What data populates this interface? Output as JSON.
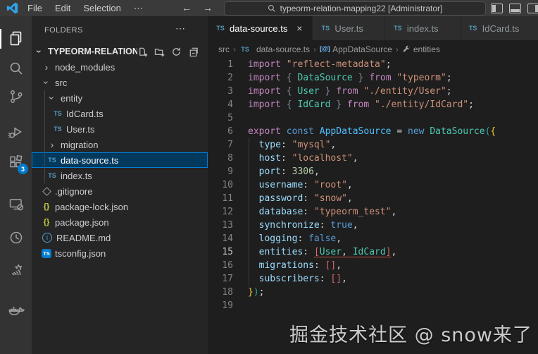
{
  "title_bar": {
    "menus": [
      "File",
      "Edit",
      "Selection"
    ],
    "more_menu": "⋯",
    "back_arrow": "←",
    "forward_arrow": "→",
    "search_text": "typeorm-relation-mapping22 [Administrator]"
  },
  "activity_bar": {
    "items": [
      {
        "name": "explorer",
        "active": true
      },
      {
        "name": "search"
      },
      {
        "name": "source-control"
      },
      {
        "name": "run-and-debug"
      },
      {
        "name": "extensions",
        "badge": "3"
      },
      {
        "name": "remote-explorer"
      },
      {
        "name": "clock"
      },
      {
        "name": "hand"
      },
      {
        "name": "docker"
      }
    ]
  },
  "sidebar": {
    "header": "FOLDERS",
    "header_more": "⋯",
    "root": {
      "label": "TYPEORM-RELATION-...",
      "expanded": true
    },
    "tree": [
      {
        "label": "node_modules",
        "depth": 1,
        "kind": "folder",
        "expanded": false
      },
      {
        "label": "src",
        "depth": 1,
        "kind": "folder",
        "expanded": true
      },
      {
        "label": "entity",
        "depth": 2,
        "kind": "folder",
        "expanded": true
      },
      {
        "label": "IdCard.ts",
        "depth": 3,
        "kind": "file",
        "icon": "ts"
      },
      {
        "label": "User.ts",
        "depth": 3,
        "kind": "file",
        "icon": "ts"
      },
      {
        "label": "migration",
        "depth": 2,
        "kind": "folder",
        "expanded": false
      },
      {
        "label": "data-source.ts",
        "depth": 2,
        "kind": "file",
        "icon": "ts",
        "selected": true
      },
      {
        "label": "index.ts",
        "depth": 2,
        "kind": "file",
        "icon": "ts"
      },
      {
        "label": ".gitignore",
        "depth": 1,
        "kind": "file",
        "icon": "git"
      },
      {
        "label": "package-lock.json",
        "depth": 1,
        "kind": "file",
        "icon": "json"
      },
      {
        "label": "package.json",
        "depth": 1,
        "kind": "file",
        "icon": "json"
      },
      {
        "label": "README.md",
        "depth": 1,
        "kind": "file",
        "icon": "info"
      },
      {
        "label": "tsconfig.json",
        "depth": 1,
        "kind": "file",
        "icon": "tsconfig"
      }
    ]
  },
  "editor_tabs": [
    {
      "label": "data-source.ts",
      "active": true
    },
    {
      "label": "User.ts"
    },
    {
      "label": "index.ts"
    },
    {
      "label": "IdCard.ts"
    }
  ],
  "breadcrumb": {
    "separator": "›",
    "items": [
      {
        "label": "src"
      },
      {
        "label": "data-source.ts",
        "icon": "ts"
      },
      {
        "label": "AppDataSource",
        "icon": "symbol-variable"
      },
      {
        "label": "entities",
        "icon": "symbol-property"
      }
    ]
  },
  "icons": {
    "ts": "TS",
    "json": "{}",
    "info": "i",
    "chevron": "›",
    "close": "×",
    "variable": "[@]"
  },
  "editor": {
    "active_line": 15,
    "lines": [
      {
        "n": 1,
        "tokens": [
          [
            "kw1",
            "import"
          ],
          [
            "pl",
            " "
          ],
          [
            "str",
            "\"reflect-metadata\""
          ],
          [
            "pl",
            ";"
          ]
        ]
      },
      {
        "n": 2,
        "tokens": [
          [
            "kw1",
            "import"
          ],
          [
            "pl",
            " "
          ],
          [
            "bd",
            "{"
          ],
          [
            "pl",
            " "
          ],
          [
            "typ",
            "DataSource"
          ],
          [
            "pl",
            " "
          ],
          [
            "bd",
            "}"
          ],
          [
            "pl",
            " "
          ],
          [
            "kw1",
            "from"
          ],
          [
            "pl",
            " "
          ],
          [
            "str",
            "\"typeorm\""
          ],
          [
            "pl",
            ";"
          ]
        ]
      },
      {
        "n": 3,
        "tokens": [
          [
            "kw1",
            "import"
          ],
          [
            "pl",
            " "
          ],
          [
            "bd",
            "{"
          ],
          [
            "pl",
            " "
          ],
          [
            "typ",
            "User"
          ],
          [
            "pl",
            " "
          ],
          [
            "bd",
            "}"
          ],
          [
            "pl",
            " "
          ],
          [
            "kw1",
            "from"
          ],
          [
            "pl",
            " "
          ],
          [
            "str",
            "\"./entity/User\""
          ],
          [
            "pl",
            ";"
          ]
        ]
      },
      {
        "n": 4,
        "tokens": [
          [
            "kw1",
            "import"
          ],
          [
            "pl",
            " "
          ],
          [
            "bd",
            "{"
          ],
          [
            "pl",
            " "
          ],
          [
            "typ",
            "IdCard"
          ],
          [
            "pl",
            " "
          ],
          [
            "bd",
            "}"
          ],
          [
            "pl",
            " "
          ],
          [
            "kw1",
            "from"
          ],
          [
            "pl",
            " "
          ],
          [
            "str",
            "\"./entity/IdCard\""
          ],
          [
            "pl",
            ";"
          ]
        ]
      },
      {
        "n": 5,
        "tokens": []
      },
      {
        "n": 6,
        "tokens": [
          [
            "kw1",
            "export"
          ],
          [
            "pl",
            " "
          ],
          [
            "kw2",
            "const"
          ],
          [
            "pl",
            " "
          ],
          [
            "cn",
            "AppDataSource"
          ],
          [
            "pl",
            " = "
          ],
          [
            "kw2",
            "new"
          ],
          [
            "pl",
            " "
          ],
          [
            "typ",
            "DataSource"
          ],
          [
            "pa",
            "("
          ],
          [
            "cu",
            "{"
          ]
        ]
      },
      {
        "n": 7,
        "tokens": [
          [
            "pl",
            "  "
          ],
          [
            "pr",
            "type"
          ],
          [
            "pl",
            ": "
          ],
          [
            "str",
            "\"mysql\""
          ],
          [
            "pl",
            ","
          ]
        ]
      },
      {
        "n": 8,
        "tokens": [
          [
            "pl",
            "  "
          ],
          [
            "pr",
            "host"
          ],
          [
            "pl",
            ": "
          ],
          [
            "str",
            "\"localhost\""
          ],
          [
            "pl",
            ","
          ]
        ]
      },
      {
        "n": 9,
        "tokens": [
          [
            "pl",
            "  "
          ],
          [
            "pr",
            "port"
          ],
          [
            "pl",
            ": "
          ],
          [
            "num",
            "3306"
          ],
          [
            "pl",
            ","
          ]
        ]
      },
      {
        "n": 10,
        "tokens": [
          [
            "pl",
            "  "
          ],
          [
            "pr",
            "username"
          ],
          [
            "pl",
            ": "
          ],
          [
            "str",
            "\"root\""
          ],
          [
            "pl",
            ","
          ]
        ]
      },
      {
        "n": 11,
        "tokens": [
          [
            "pl",
            "  "
          ],
          [
            "pr",
            "password"
          ],
          [
            "pl",
            ": "
          ],
          [
            "str",
            "\"snow\""
          ],
          [
            "pl",
            ","
          ]
        ]
      },
      {
        "n": 12,
        "tokens": [
          [
            "pl",
            "  "
          ],
          [
            "pr",
            "database"
          ],
          [
            "pl",
            ": "
          ],
          [
            "str",
            "\"typeorm_test\""
          ],
          [
            "pl",
            ","
          ]
        ]
      },
      {
        "n": 13,
        "tokens": [
          [
            "pl",
            "  "
          ],
          [
            "pr",
            "synchronize"
          ],
          [
            "pl",
            ": "
          ],
          [
            "kw2",
            "true"
          ],
          [
            "pl",
            ","
          ]
        ]
      },
      {
        "n": 14,
        "tokens": [
          [
            "pl",
            "  "
          ],
          [
            "pr",
            "logging"
          ],
          [
            "pl",
            ": "
          ],
          [
            "kw2",
            "false"
          ],
          [
            "pl",
            ","
          ]
        ]
      },
      {
        "n": 15,
        "tokens": [
          [
            "pl",
            "  "
          ],
          [
            "pr",
            "entities"
          ],
          [
            "pl",
            ": "
          ],
          [
            "sq u",
            "["
          ],
          [
            "typ u",
            "User"
          ],
          [
            "pl u",
            ", "
          ],
          [
            "typ u",
            "IdCard"
          ],
          [
            "sq u",
            "]"
          ],
          [
            "pl",
            ","
          ]
        ]
      },
      {
        "n": 16,
        "tokens": [
          [
            "pl",
            "  "
          ],
          [
            "pr",
            "migrations"
          ],
          [
            "pl",
            ": "
          ],
          [
            "sq",
            "[]"
          ],
          [
            "pl",
            ","
          ]
        ]
      },
      {
        "n": 17,
        "tokens": [
          [
            "pl",
            "  "
          ],
          [
            "pr",
            "subscribers"
          ],
          [
            "pl",
            ": "
          ],
          [
            "sq",
            "[]"
          ],
          [
            "pl",
            ","
          ]
        ]
      },
      {
        "n": 18,
        "tokens": [
          [
            "cu",
            "}"
          ],
          [
            "pa",
            ")"
          ],
          [
            "pl",
            ";"
          ]
        ]
      },
      {
        "n": 19,
        "tokens": []
      }
    ]
  },
  "watermark": "掘金技术社区 @ snow来了",
  "colors": {
    "accent": "#007acc",
    "list_selection_bg": "#04395e",
    "list_selection_border": "#007fd4",
    "keyword_control": "#c586c0",
    "keyword": "#569cd6",
    "string": "#ce9178",
    "type": "#4ec9b0",
    "constant": "#4fc1ff",
    "property": "#9cdcfe",
    "number": "#b5cea8",
    "bracket_curly": "#e9c62f",
    "bracket_paren": "#29a89d",
    "bracket_square": "#d16969",
    "error_underline": "#c74e39"
  }
}
